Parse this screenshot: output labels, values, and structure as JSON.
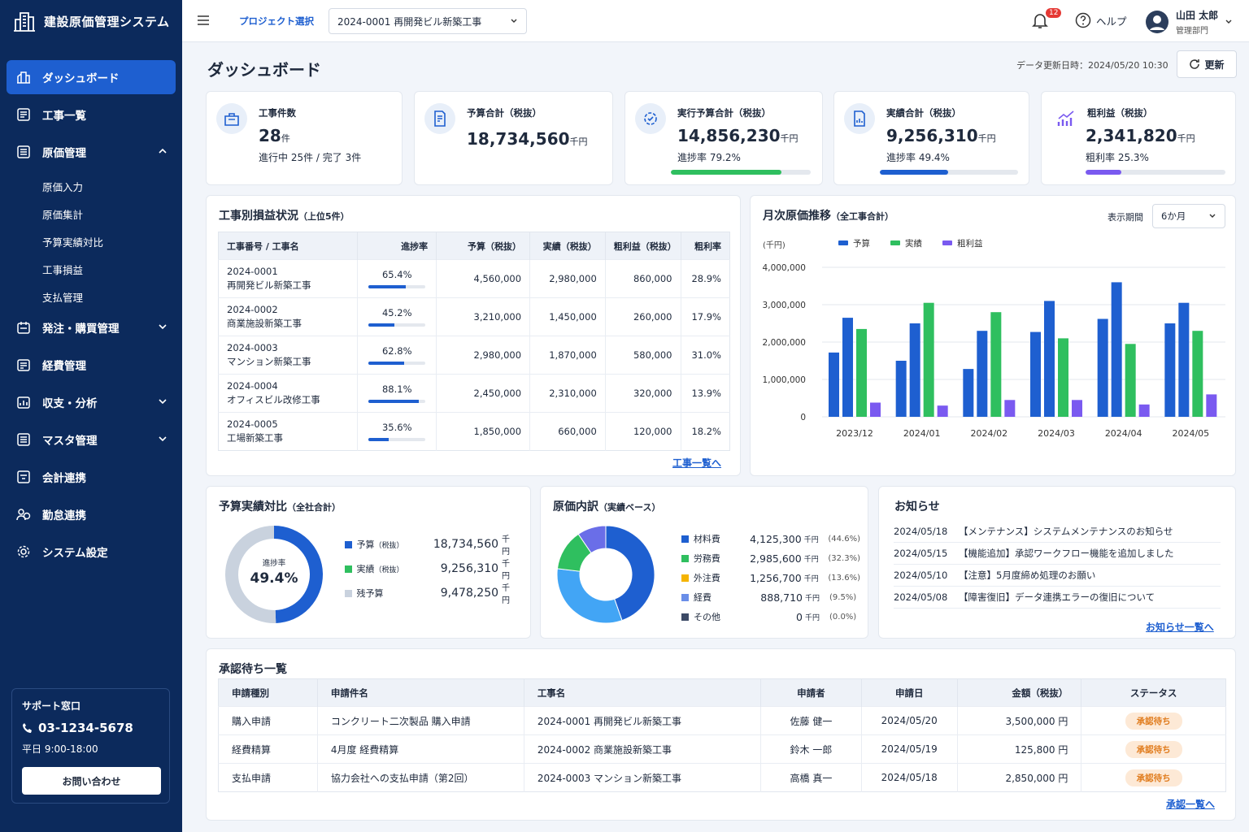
{
  "app": {
    "title": "建設原価管理システム"
  },
  "sidebar": {
    "items": [
      {
        "label": "ダッシュボード",
        "icon": "dashboard-icon"
      },
      {
        "label": "工事一覧",
        "icon": "list-icon"
      },
      {
        "label": "原価管理",
        "icon": "cost-icon"
      },
      {
        "label": "発注・購買管理",
        "icon": "order-icon"
      },
      {
        "label": "経費管理",
        "icon": "expense-icon"
      },
      {
        "label": "収支・分析",
        "icon": "analysis-icon"
      },
      {
        "label": "マスタ管理",
        "icon": "master-icon"
      },
      {
        "label": "会計連携",
        "icon": "accounting-icon"
      },
      {
        "label": "勤怠連携",
        "icon": "attendance-icon"
      },
      {
        "label": "システム設定",
        "icon": "settings-icon"
      }
    ],
    "sub_items": [
      "原価入力",
      "原価集計",
      "予算実績対比",
      "工事損益",
      "支払管理"
    ],
    "support": {
      "title": "サポート窓口",
      "phone": "03-1234-5678",
      "hours": "平日 9:00-18:00",
      "button": "お問い合わせ"
    }
  },
  "header": {
    "project_label": "プロジェクト選択",
    "project_value": "2024-0001 再開発ビル新築工事",
    "notification_count": "12",
    "help": "ヘルプ",
    "user_name": "山田 太郎",
    "user_dept": "管理部門"
  },
  "page": {
    "title": "ダッシュボード",
    "updated": "データ更新日時：2024/05/20 10:30",
    "refresh": "更新"
  },
  "kpis": [
    {
      "label": "工事件数",
      "value": "28",
      "unit": "件",
      "sub": "進行中 25件 / 完了 3件"
    },
    {
      "label": "予算合計（税抜）",
      "value": "18,734,560",
      "unit": "千円"
    },
    {
      "label": "実行予算合計（税抜）",
      "value": "14,856,230",
      "unit": "千円",
      "sub": "進捗率 79.2%",
      "progress": 0.792,
      "color": "#2fbf5f"
    },
    {
      "label": "実績合計（税抜）",
      "value": "9,256,310",
      "unit": "千円",
      "sub": "進捗率 49.4%",
      "progress": 0.494,
      "color": "#1e5fd0"
    },
    {
      "label": "粗利益（税抜）",
      "value": "2,341,820",
      "unit": "千円",
      "sub": "粗利率 25.3%",
      "progress": 0.253,
      "color": "#7a5af0"
    }
  ],
  "profit": {
    "title": "工事別損益状況",
    "title_note": "（上位5件）",
    "columns": [
      "工事番号 / 工事名",
      "進捗率",
      "予算（税抜）",
      "実績（税抜）",
      "粗利益（税抜）",
      "粗利率"
    ],
    "rows": [
      {
        "no": "2024-0001",
        "name": "再開発ビル新築工事",
        "progress": "65.4%",
        "p": 0.654,
        "budget": "4,560,000",
        "actual": "2,980,000",
        "profit": "860,000",
        "rate": "28.9%"
      },
      {
        "no": "2024-0002",
        "name": "商業施設新築工事",
        "progress": "45.2%",
        "p": 0.452,
        "budget": "3,210,000",
        "actual": "1,450,000",
        "profit": "260,000",
        "rate": "17.9%"
      },
      {
        "no": "2024-0003",
        "name": "マンション新築工事",
        "progress": "62.8%",
        "p": 0.628,
        "budget": "2,980,000",
        "actual": "1,870,000",
        "profit": "580,000",
        "rate": "31.0%"
      },
      {
        "no": "2024-0004",
        "name": "オフィスビル改修工事",
        "progress": "88.1%",
        "p": 0.881,
        "budget": "2,450,000",
        "actual": "2,310,000",
        "profit": "320,000",
        "rate": "13.9%"
      },
      {
        "no": "2024-0005",
        "name": "工場新築工事",
        "progress": "35.6%",
        "p": 0.356,
        "budget": "1,850,000",
        "actual": "660,000",
        "profit": "120,000",
        "rate": "18.2%"
      }
    ],
    "link": "工事一覧へ"
  },
  "monthly": {
    "title": "月次原価推移",
    "title_note": "（全工事合計）",
    "period_label": "表示期間",
    "period_value": "6か月",
    "unit": "(千円)"
  },
  "chart_data": {
    "type": "bar",
    "categories": [
      "2023/12",
      "2024/01",
      "2024/02",
      "2024/03",
      "2024/04",
      "2024/05"
    ],
    "series": [
      {
        "name": "予算",
        "color": "#1e5fd0",
        "values": [
          2650000,
          2500000,
          2300000,
          3100000,
          3600000,
          3050000
        ]
      },
      {
        "name": "実績",
        "color": "#2fbf5f",
        "values": [
          2350000,
          3050000,
          2800000,
          2100000,
          1950000,
          2300000
        ]
      },
      {
        "name": "粗利益",
        "color": "#7a5af0",
        "values": [
          380000,
          300000,
          450000,
          450000,
          330000,
          600000
        ]
      }
    ],
    "extra_bar": [
      1720000,
      1500000,
      1280000,
      2270000,
      2620000,
      2500000
    ],
    "ylim": [
      0,
      4000000
    ],
    "yticks": [
      "0",
      "1,000,000",
      "2,000,000",
      "3,000,000",
      "4,000,000"
    ],
    "grid": true,
    "legend": "top"
  },
  "budget_vs_actual": {
    "title": "予算実績対比",
    "title_note": "（全社合計）",
    "center_label": "進捗率",
    "center_value": "49.4%",
    "progress": 0.494,
    "rows": [
      {
        "label": "予算",
        "note": "（税抜）",
        "value": "18,734,560",
        "unit": "千円",
        "color": "#1e5fd0"
      },
      {
        "label": "実績",
        "note": "（税抜）",
        "value": "9,256,310",
        "unit": "千円",
        "color": "#2fbf5f"
      },
      {
        "label": "残予算",
        "note": "",
        "value": "9,478,250",
        "unit": "千円",
        "color": "#c9d2de"
      }
    ]
  },
  "cost_breakdown": {
    "title": "原価内訳",
    "title_note": "（実績ベース）",
    "rows": [
      {
        "label": "材料費",
        "value": "4,125,300",
        "unit": "千円",
        "pct": "(44.6%)",
        "share": 44.6,
        "color": "#1e5fd0"
      },
      {
        "label": "労務費",
        "value": "2,985,600",
        "unit": "千円",
        "pct": "(32.3%)",
        "share": 32.3,
        "color": "#42a5f5"
      },
      {
        "label": "外注費",
        "value": "1,256,700",
        "unit": "千円",
        "pct": "(13.6%)",
        "share": 13.6,
        "color": "#2fbf5f"
      },
      {
        "label": "経費",
        "value": "888,710",
        "unit": "千円",
        "pct": "(9.5%)",
        "share": 9.5,
        "color": "#6a6ee8"
      },
      {
        "label": "その他",
        "value": "0",
        "unit": "千円",
        "pct": "(0.0%)",
        "share": 0,
        "color": "#3c4a66"
      }
    ],
    "legend_colors": [
      "#1e5fd0",
      "#2fbf5f",
      "#f5b400",
      "#6a8ee8",
      "#3c4a66"
    ]
  },
  "news": {
    "title": "お知らせ",
    "items": [
      {
        "date": "2024/05/18",
        "text": "【メンテナンス】システムメンテナンスのお知らせ"
      },
      {
        "date": "2024/05/15",
        "text": "【機能追加】承認ワークフロー機能を追加しました"
      },
      {
        "date": "2024/05/10",
        "text": "【注意】5月度締め処理のお願い"
      },
      {
        "date": "2024/05/08",
        "text": "【障害復旧】データ連携エラーの復旧について"
      }
    ],
    "link": "お知らせ一覧へ"
  },
  "approvals": {
    "title": "承認待ち一覧",
    "columns": [
      "申請種別",
      "申請件名",
      "工事名",
      "申請者",
      "申請日",
      "金額（税抜）",
      "ステータス"
    ],
    "rows": [
      {
        "type": "購入申請",
        "subject": "コンクリート二次製品 購入申請",
        "project": "2024-0001 再開発ビル新築工事",
        "applicant": "佐藤 健一",
        "date": "2024/05/20",
        "amount": "3,500,000 円",
        "status": "承認待ち"
      },
      {
        "type": "経費精算",
        "subject": "4月度 経費精算",
        "project": "2024-0002 商業施設新築工事",
        "applicant": "鈴木 一郎",
        "date": "2024/05/19",
        "amount": "125,800 円",
        "status": "承認待ち"
      },
      {
        "type": "支払申請",
        "subject": "協力会社への支払申請（第2回）",
        "project": "2024-0003 マンション新築工事",
        "applicant": "高橋 真一",
        "date": "2024/05/18",
        "amount": "2,850,000 円",
        "status": "承認待ち"
      }
    ],
    "link": "承認一覧へ"
  }
}
